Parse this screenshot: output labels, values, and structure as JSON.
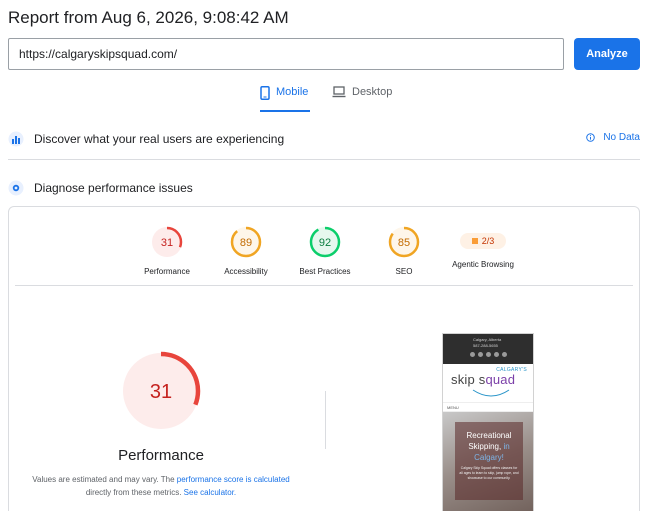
{
  "header": {
    "title": "Report from Aug 6, 2026, 9:08:42 AM"
  },
  "url_bar": {
    "value": "https://calgaryskipsquad.com/",
    "analyze_label": "Analyze"
  },
  "tabs": [
    {
      "label": "Mobile",
      "active": true,
      "icon": "smartphone-icon"
    },
    {
      "label": "Desktop",
      "active": false,
      "icon": "laptop-icon"
    }
  ],
  "field_data": {
    "title": "Discover what your real users are experiencing",
    "status": "No Data",
    "icon": "users-chart-icon"
  },
  "diagnose": {
    "title": "Diagnose performance issues",
    "icon": "lab-flask-icon"
  },
  "scores": [
    {
      "label": "Performance",
      "score": "31",
      "fraction": 0.31,
      "color": "#e8453c",
      "bg": "#fdeceb"
    },
    {
      "label": "Accessibility",
      "score": "89",
      "fraction": 0.89,
      "color": "#f0a523",
      "bg": "#fef6ea"
    },
    {
      "label": "Best Practices",
      "score": "92",
      "fraction": 0.92,
      "color": "#0cce6b",
      "bg": "#e6f8ee"
    },
    {
      "label": "SEO",
      "score": "85",
      "fraction": 0.85,
      "color": "#f0a523",
      "bg": "#fef6ea"
    }
  ],
  "agentic": {
    "label": "Agentic Browsing",
    "value": "2/3"
  },
  "main_gauge": {
    "score": "31",
    "fraction": 0.31,
    "label": "Performance",
    "note_prefix": "Values are estimated and may vary. The ",
    "note_link": "performance score is calculated",
    "note_mid": " directly from these metrics. ",
    "note_link2": "See calculator."
  },
  "preview": {
    "address_line": "Calgary, Alberta",
    "phone_line": "587-288-5655",
    "logo_small": "CALGARY'S",
    "logo_main_1": "skip s",
    "logo_main_accent": "quad",
    "menu": "MENU",
    "hero_title_1": "Recreational",
    "hero_title_2": "Skipping, ",
    "hero_title_accent_1": "in",
    "hero_title_accent_2": "Calgary!",
    "hero_text": "Calgary Skip Squad offers classes for all ages to learn to skip, jump rope, and showcase to our community."
  },
  "colors": {
    "accent": "#1a73e8",
    "poor": "#e8453c",
    "average": "#f0a523",
    "good": "#0cce6b"
  }
}
